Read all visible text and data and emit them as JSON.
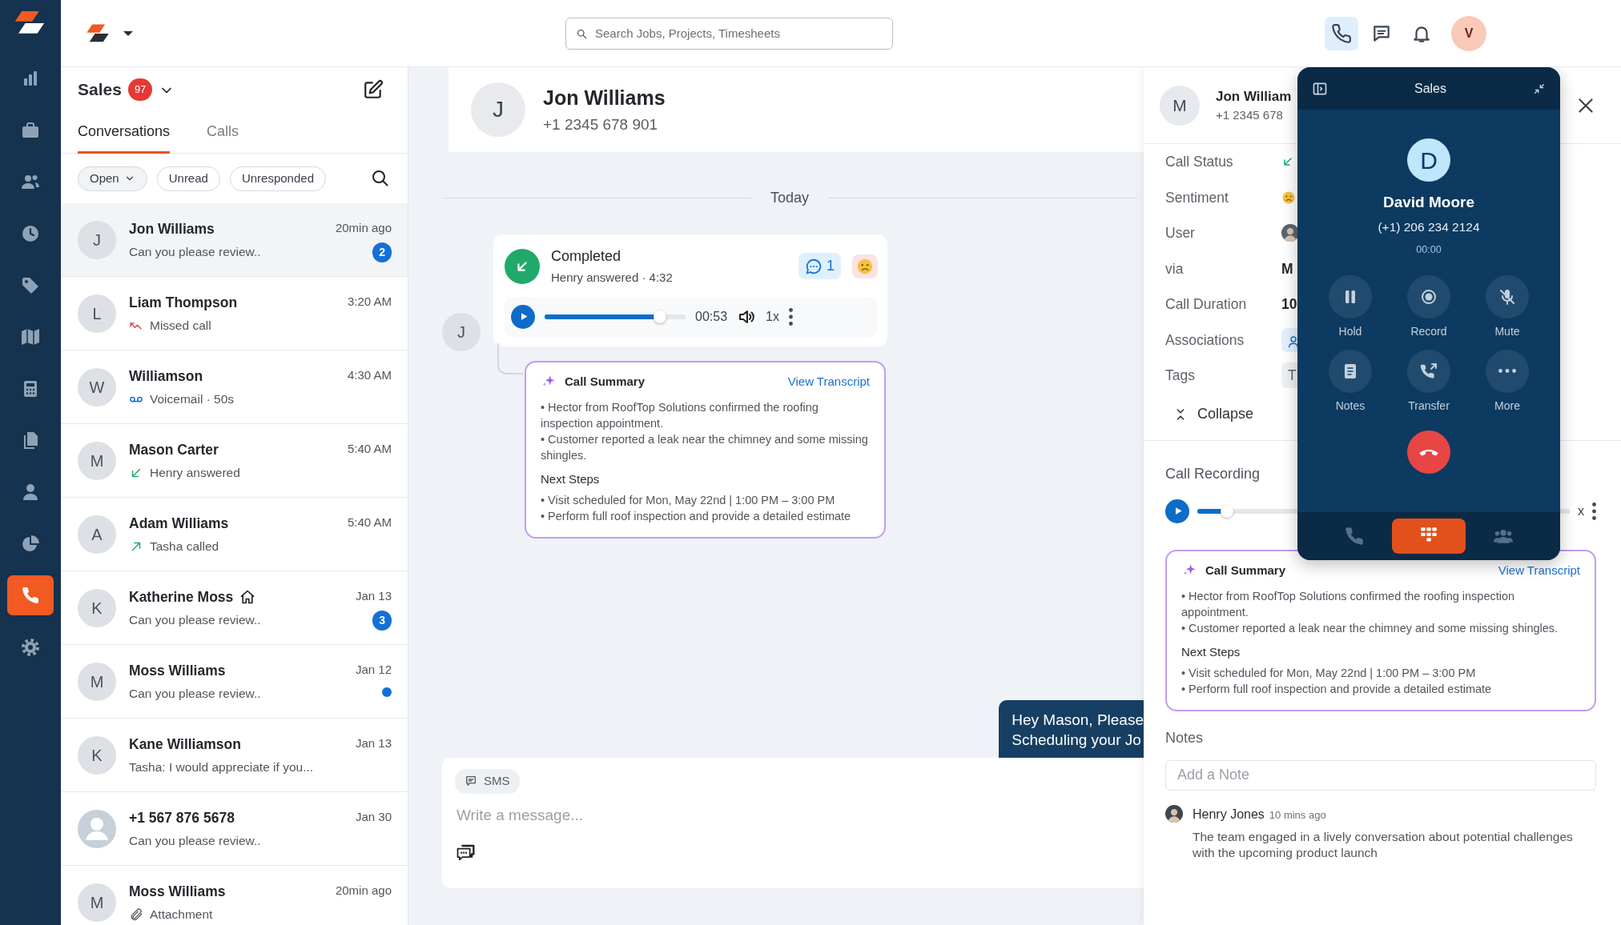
{
  "rail": {
    "items": [
      {
        "selected": false
      },
      {
        "selected": false
      },
      {
        "selected": false
      },
      {
        "selected": false
      },
      {
        "selected": false
      },
      {
        "selected": false
      },
      {
        "selected": false
      },
      {
        "selected": false
      },
      {
        "selected": false
      },
      {
        "selected": false
      },
      {
        "selected": true
      },
      {
        "selected": false
      }
    ]
  },
  "topbar": {
    "search": {
      "placeholder": "Search Jobs, Projects, Timesheets"
    },
    "actions": [
      {
        "selected": true
      },
      {
        "selected": false
      },
      {
        "selected": false
      }
    ],
    "avatar": "V"
  },
  "inbox": {
    "title": "Sales",
    "count": "97",
    "tabs": [
      {
        "label": "Conversations",
        "selected": true
      },
      {
        "label": "Calls",
        "selected": false
      }
    ],
    "filters": [
      {
        "label": "Open",
        "kind": "dropdown"
      },
      {
        "label": "Unread",
        "kind": "chip"
      },
      {
        "label": "Unresponded",
        "kind": "chip"
      }
    ],
    "conversations": [
      {
        "initial": "J",
        "name": "Jon Williams",
        "time": "20min ago",
        "kind": "text",
        "preview": "Can you please review..",
        "badge": "2",
        "unread": false,
        "home": false,
        "selected": true
      },
      {
        "initial": "L",
        "name": "Liam Thompson",
        "time": "3:20 AM",
        "kind": "missed",
        "preview": "Missed call",
        "unread": false,
        "home": false,
        "selected": false
      },
      {
        "initial": "W",
        "name": "Williamson",
        "time": "4:30 AM",
        "kind": "voicemail",
        "preview": "Voicemail · 50s",
        "unread": false,
        "home": false,
        "selected": false
      },
      {
        "initial": "M",
        "name": "Mason Carter",
        "time": "5:40 AM",
        "kind": "incoming",
        "preview": "Henry answered",
        "unread": false,
        "home": false,
        "selected": false
      },
      {
        "initial": "A",
        "name": "Adam Williams",
        "time": "5:40 AM",
        "kind": "outgoing",
        "preview": "Tasha called",
        "unread": false,
        "home": false,
        "selected": false
      },
      {
        "initial": "K",
        "name": "Katherine Moss",
        "time": "Jan 13",
        "kind": "text",
        "preview": "Can you please review..",
        "badge": "3",
        "unread": false,
        "home": true,
        "selected": false
      },
      {
        "initial": "M",
        "name": "Moss Williams",
        "time": "Jan 12",
        "kind": "text",
        "preview": "Can you please review..",
        "unread": true,
        "home": false,
        "selected": false
      },
      {
        "initial": "K",
        "name": "Kane Williamson",
        "time": "Jan 13",
        "kind": "text",
        "preview": "Tasha: I would appreciate if you...",
        "unread": false,
        "home": false,
        "selected": false
      },
      {
        "name": "+1 567 876 5678",
        "time": "Jan 30",
        "kind": "text",
        "preview": "Can you please review..",
        "unread": false,
        "home": false,
        "selected": false
      },
      {
        "initial": "M",
        "name": "Moss Williams",
        "time": "20min ago",
        "kind": "attachment",
        "preview": "Attachment",
        "unread": false,
        "home": false,
        "selected": false
      }
    ]
  },
  "conversation": {
    "contact": {
      "initial": "J",
      "name": "Jon Williams",
      "phone": "+1 2345 678 901"
    },
    "day": "Today",
    "call": {
      "initial": "J",
      "status": "Completed",
      "detail": "Henry answered · 4:32",
      "comments": "1",
      "time": "00:53",
      "speed": "1x",
      "level": 0.82
    },
    "summary": {
      "title": "Call Summary",
      "link": "View Transcript",
      "points": [
        "• Hector from RoofTop Solutions confirmed the roofing inspection appointment.",
        "• Customer reported a leak near the chimney and some missing shingles."
      ],
      "next_title": "Next Steps",
      "next_points": [
        "• Visit scheduled for Mon, May 22nd | 1:00 PM – 3:00 PM",
        "• Perform full roof inspection and provide a detailed estimate"
      ]
    },
    "outgoing": [
      "Hey Mason, Please",
      "Scheduling your Jo"
    ],
    "composer": {
      "channel": "SMS",
      "placeholder": "Write a message..."
    }
  },
  "details": {
    "contact": {
      "initial": "M",
      "name": "Jon William",
      "phone": "+1 2345 678"
    },
    "fields": [
      {
        "label": "Call Status",
        "kind": "status"
      },
      {
        "label": "Sentiment",
        "kind": "emoji"
      },
      {
        "label": "User",
        "kind": "user"
      },
      {
        "label": "via",
        "kind": "text",
        "value": "M"
      },
      {
        "label": "Call Duration",
        "kind": "text",
        "value": "10"
      },
      {
        "label": "Associations",
        "kind": "association"
      },
      {
        "label": "Tags",
        "kind": "tag",
        "value": "T"
      }
    ],
    "collapse": "Collapse",
    "recording": {
      "title": "Call Recording",
      "level": 0.08,
      "speed": "x"
    },
    "summary": {
      "title": "Call Summary",
      "link": "View Transcript",
      "points": [
        "• Hector from RoofTop Solutions confirmed the roofing inspection appointment.",
        "• Customer reported a leak near the chimney and some missing shingles."
      ],
      "next_title": "Next Steps",
      "next_points": [
        "• Visit scheduled for Mon, May 22nd | 1:00 PM – 3:00 PM",
        "• Perform full roof inspection and provide a detailed estimate"
      ]
    },
    "notes": {
      "title": "Notes",
      "placeholder": "Add a Note",
      "items": [
        {
          "author": "Henry Jones",
          "time": "10 mins ago",
          "text": "The team engaged in a lively conversation about potential challenges with the upcoming product launch"
        }
      ]
    }
  },
  "dialer": {
    "title": "Sales",
    "initial": "D",
    "name": "David Moore",
    "phone": "(+1) 206 234 2124",
    "timer": "00:00",
    "actions": [
      {
        "label": "Hold"
      },
      {
        "label": "Record"
      },
      {
        "label": "Mute"
      },
      {
        "label": "Notes"
      },
      {
        "label": "Transfer"
      },
      {
        "label": "More"
      }
    ],
    "tabs": [
      {
        "selected": false
      },
      {
        "selected": true
      },
      {
        "selected": false
      }
    ]
  }
}
